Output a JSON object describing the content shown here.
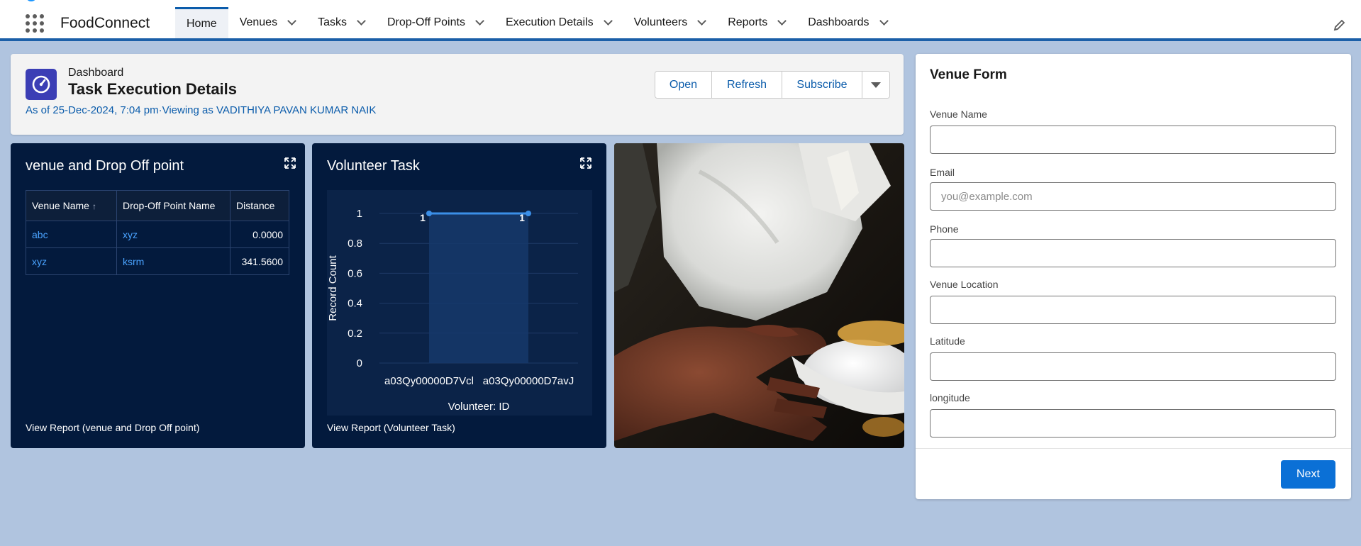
{
  "app": {
    "name": "FoodConnect"
  },
  "nav": {
    "tabs": [
      {
        "label": "Home"
      },
      {
        "label": "Venues"
      },
      {
        "label": "Tasks"
      },
      {
        "label": "Drop-Off Points"
      },
      {
        "label": "Execution Details"
      },
      {
        "label": "Volunteers"
      },
      {
        "label": "Reports"
      },
      {
        "label": "Dashboards"
      }
    ]
  },
  "dashboard": {
    "type_label": "Dashboard",
    "title": "Task Execution Details",
    "meta": "As of 25-Dec-2024, 7:04 pm·Viewing as VADITHIYA PAVAN KUMAR NAIK",
    "buttons": {
      "open": "Open",
      "refresh": "Refresh",
      "subscribe": "Subscribe"
    }
  },
  "widgets": {
    "table_widget": {
      "title": "venue and Drop Off point",
      "columns": [
        "Venue Name",
        "Drop-Off Point Name",
        "Distance"
      ],
      "sort_indicator": "↑",
      "rows": [
        [
          "abc",
          "xyz",
          "0.0000"
        ],
        [
          "xyz",
          "ksrm",
          "341.5600"
        ]
      ],
      "footer": "View Report (venue and Drop Off point)"
    },
    "chart_widget": {
      "title": "Volunteer Task",
      "footer": "View Report (Volunteer Task)"
    }
  },
  "chart_data": {
    "type": "line",
    "title": "Volunteer Task",
    "categories": [
      "a03Qy00000D7Vcl",
      "a03Qy00000D7avJ"
    ],
    "series": [
      {
        "values": [
          1,
          1
        ]
      }
    ],
    "data_labels": [
      "1",
      "1"
    ],
    "xlabel": "Volunteer: ID",
    "ylabel": "Record Count",
    "ylim": [
      0,
      1
    ],
    "yticks": [
      "0",
      "0.2",
      "0.4",
      "0.6",
      "0.8",
      "1"
    ],
    "grid": true,
    "color": "#3b8fe8"
  },
  "form": {
    "title": "Venue Form",
    "fields": [
      {
        "label": "Venue Name",
        "value": "",
        "placeholder": ""
      },
      {
        "label": "Email",
        "value": "",
        "placeholder": "you@example.com"
      },
      {
        "label": "Phone",
        "value": "",
        "placeholder": ""
      },
      {
        "label": "Venue Location",
        "value": "",
        "placeholder": ""
      },
      {
        "label": "Latitude",
        "value": "",
        "placeholder": ""
      },
      {
        "label": "longitude",
        "value": "",
        "placeholder": ""
      }
    ],
    "next_label": "Next"
  },
  "colors": {
    "accent": "#0b5cab",
    "widget_bg": "#031a3d",
    "button_brand": "#0b70d6"
  }
}
